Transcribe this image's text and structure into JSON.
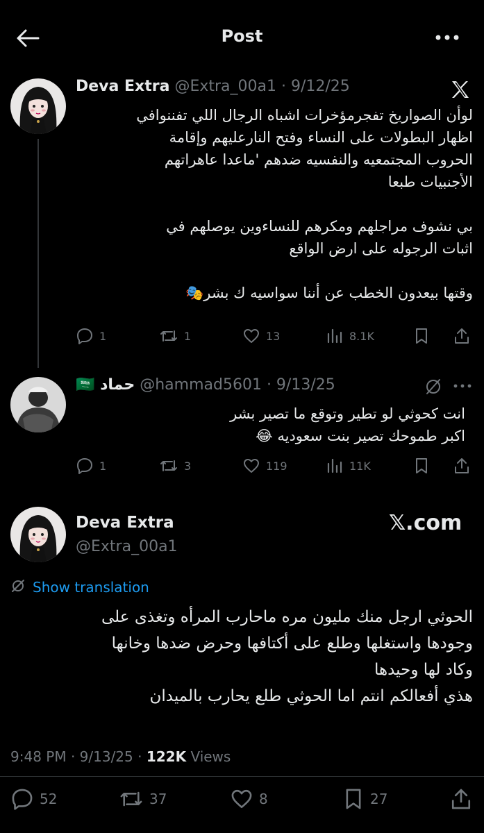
{
  "header": {
    "title": "Post"
  },
  "tweets": [
    {
      "name": "Deva Extra",
      "handle": "@Extra_00a1 · 9/12/25",
      "text": "لوأن الصواريخ تفجرمؤخرات اشباه الرجال اللي تفننوافي\nاظهار البطولات على النساء وفتح النارعليهم وإقامة\nالحروب المجتمعيه والنفسيه ضدهم 'ماعدا عاهراتهم\nالأجنبيات طبعا\n\nبي نشوف مراجلهم ومكرهم للنساءوين يوصلهم في\nاثبات الرجوله على ارض الواقع\n\nوقتها بيعدون الخطب عن أننا سواسيه ك بشر🎭",
      "replies": "1",
      "reposts": "1",
      "likes": "13",
      "views": "8.1K"
    },
    {
      "name": "حماد",
      "flag": "🇸🇦",
      "handle": "@hammad5601 · 9/13/25",
      "text": "انت كحوثي لو تطير وتوقع ما تصير بشر\nاكبر طموحك تصير بنت سعوديه 😂",
      "replies": "1",
      "reposts": "3",
      "likes": "119",
      "views": "11K"
    }
  ],
  "main": {
    "name": "Deva Extra",
    "handle": "@Extra_00a1",
    "watermark": "𝕏.com",
    "show_translation": "Show translation",
    "text": "الحوثي ارجل منك مليون مره ماحارب المرأه وتغذى على\nوجودها واستغلها وطلع على أكتافها وحرض ضدها وخانها\nوكاد لها وحيدها\nهذي أفعالكم انتم اما الحوثي طلع يحارب بالميدان",
    "time": "9:48 PM · 9/13/25 · ",
    "views_count": "122K",
    "views_label": " Views",
    "replies": "52",
    "reposts": "37",
    "likes": "8",
    "bookmarks": "27"
  }
}
